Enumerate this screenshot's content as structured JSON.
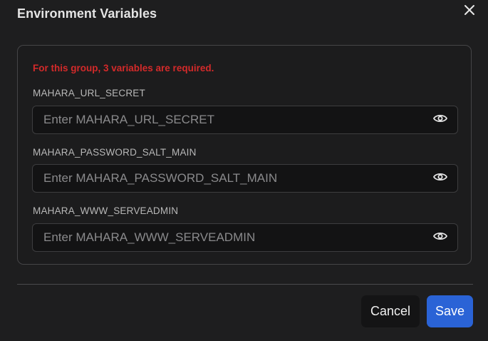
{
  "dialog": {
    "title": "Environment Variables",
    "close_icon": "close-icon"
  },
  "group": {
    "requirement_text": "For this group, 3 variables are required.",
    "fields": [
      {
        "label": "MAHARA_URL_SECRET",
        "placeholder": "Enter MAHARA_URL_SECRET",
        "value": "",
        "icon": "eye-icon"
      },
      {
        "label": "MAHARA_PASSWORD_SALT_MAIN",
        "placeholder": "Enter MAHARA_PASSWORD_SALT_MAIN",
        "value": "",
        "icon": "eye-icon"
      },
      {
        "label": "MAHARA_WWW_SERVEADMIN",
        "placeholder": "Enter MAHARA_WWW_SERVEADMIN",
        "value": "",
        "icon": "eye-icon"
      }
    ]
  },
  "footer": {
    "cancel_label": "Cancel",
    "save_label": "Save"
  },
  "colors": {
    "background": "#1e1e1f",
    "requirement": "#d42a2a",
    "primary": "#2a63d6"
  }
}
